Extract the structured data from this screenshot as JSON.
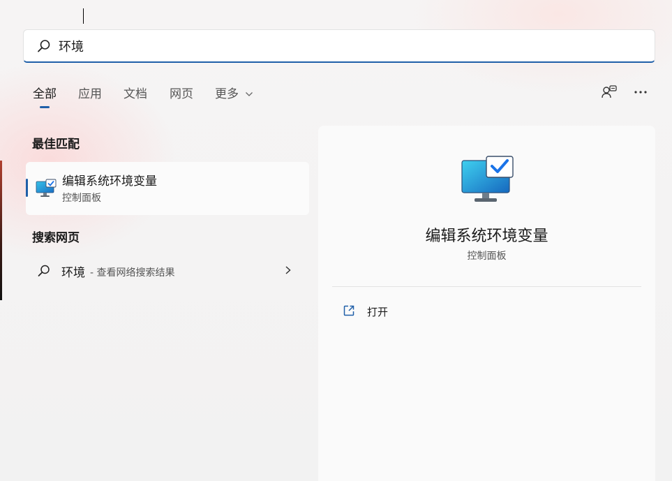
{
  "search": {
    "query": "环境",
    "icon": "search-icon"
  },
  "tabs": [
    {
      "label": "全部",
      "active": true
    },
    {
      "label": "应用",
      "active": false
    },
    {
      "label": "文档",
      "active": false
    },
    {
      "label": "网页",
      "active": false
    },
    {
      "label": "更多",
      "active": false,
      "has_dropdown": true
    }
  ],
  "toolbar": {
    "account_icon": "account-switch-icon",
    "more_icon": "more-options-icon"
  },
  "best_match": {
    "heading": "最佳匹配",
    "item": {
      "name": "编辑系统环境变量",
      "category": "控制面板",
      "icon": "system-monitor-check-icon"
    }
  },
  "web_search": {
    "heading": "搜索网页",
    "query": "环境",
    "hint": "- 查看网络搜索结果",
    "icon": "search-icon"
  },
  "detail": {
    "title": "编辑系统环境变量",
    "subtitle": "控制面板",
    "actions": [
      {
        "label": "打开",
        "icon": "open-external-icon"
      }
    ]
  },
  "colors": {
    "accent": "#1f5fa8",
    "background": "#f3f3f3",
    "panel": "#fafafa"
  }
}
